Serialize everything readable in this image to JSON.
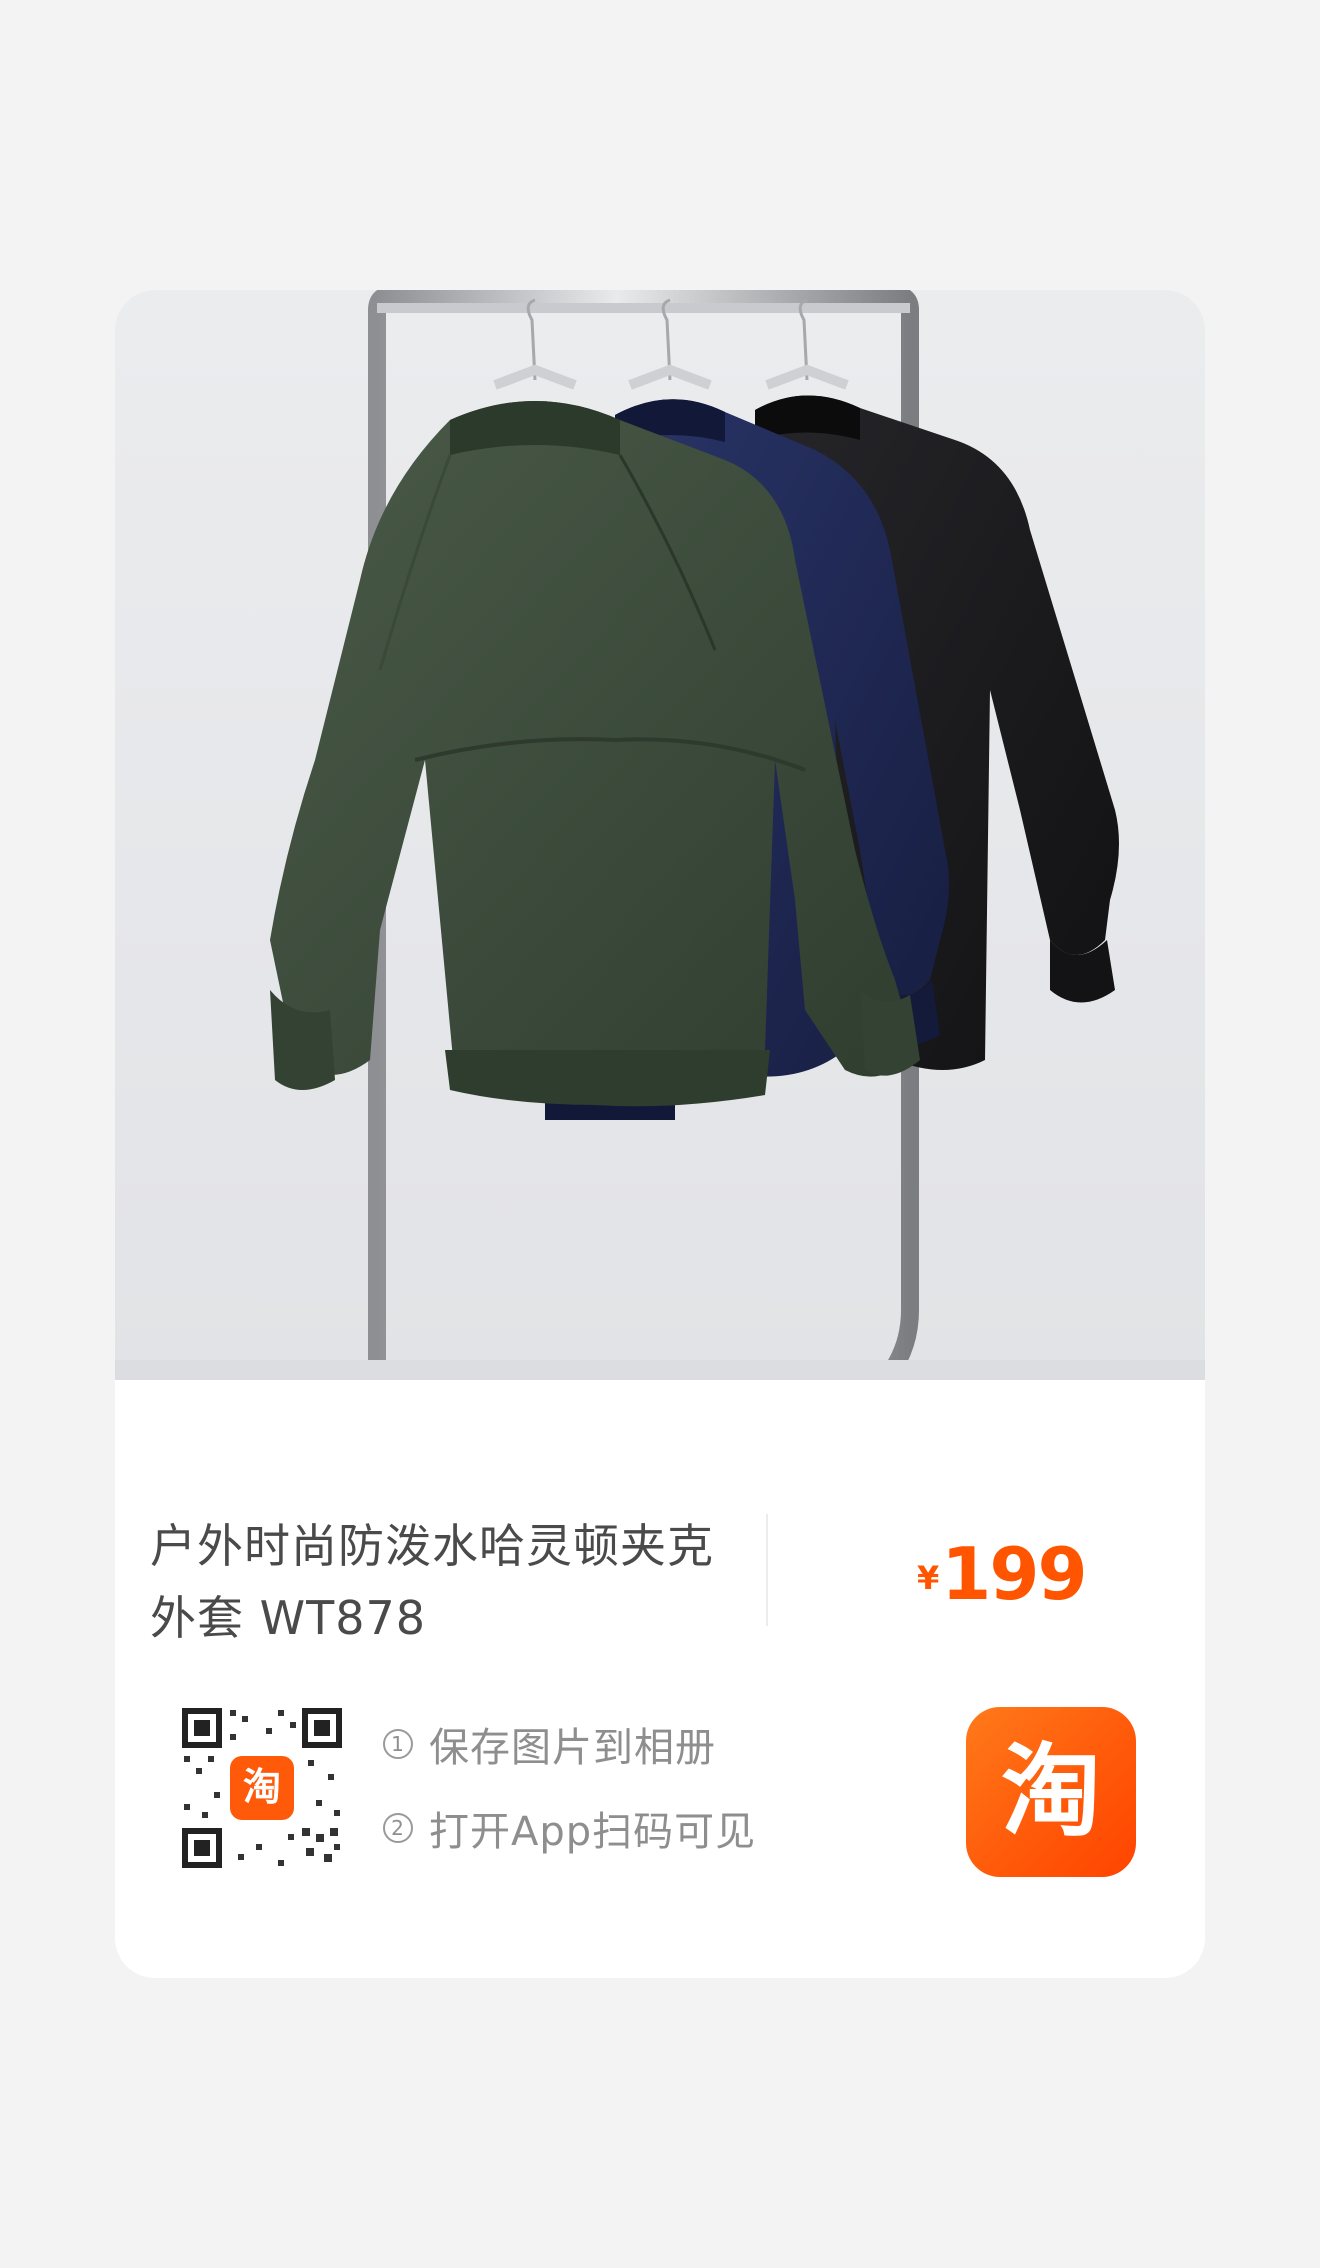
{
  "product": {
    "title_line1": "户外时尚防泼水哈灵顿夹克",
    "title_line2": "外套 WT878",
    "currency": "¥",
    "price": "199"
  },
  "share": {
    "qr_badge": "淘",
    "step1_num": "1",
    "step1_text": "保存图片到相册",
    "step2_num": "2",
    "step2_text": "打开App扫码可见"
  },
  "app": {
    "icon_glyph": "淘",
    "icon_name": "taobao-icon"
  },
  "colors": {
    "price": "#ff5500",
    "brand_orange": "#ff5a0a",
    "jacket_green": "#3a4a3a",
    "jacket_navy": "#1f2a55",
    "jacket_black": "#1a1a1c"
  }
}
